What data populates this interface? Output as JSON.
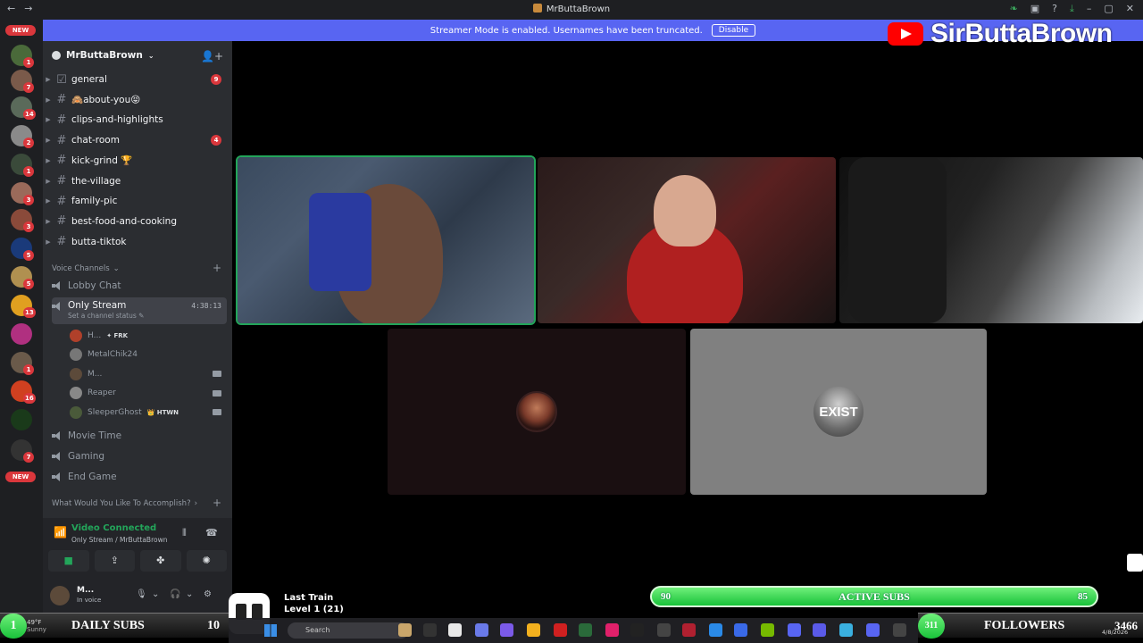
{
  "window": {
    "title": "MrButtaBrown"
  },
  "banner": {
    "text": "Streamer Mode is enabled. Usernames have been truncated.",
    "button": "Disable"
  },
  "youtube_overlay": {
    "channel": "SirButtaBrown"
  },
  "rail": {
    "items": [
      {
        "badge": "NEW",
        "color": "#6a8e5a"
      },
      {
        "badge": "1",
        "color": "#4a6a3a"
      },
      {
        "badge": "7",
        "color": "#7a5a4a"
      },
      {
        "badge": "14",
        "color": "#5a6a5a"
      },
      {
        "badge": "2",
        "color": "#8a8a8a"
      },
      {
        "badge": "1",
        "color": "#3a4a3a"
      },
      {
        "badge": "3",
        "color": "#9a6a5a"
      },
      {
        "badge": "3",
        "color": "#8a4a3a"
      },
      {
        "badge": "5",
        "color": "#1a3a7a"
      },
      {
        "badge": "5",
        "color": "#b09050"
      },
      {
        "badge": "13",
        "color": "#e0a020"
      },
      {
        "badge": "",
        "color": "#b03080"
      },
      {
        "badge": "1",
        "color": "#6a5a4a"
      },
      {
        "badge": "16",
        "color": "#d04020"
      },
      {
        "badge": "",
        "color": "#1a3a1a"
      },
      {
        "badge": "7",
        "color": "#333333"
      },
      {
        "badge": "NEW",
        "color": "#111111"
      }
    ]
  },
  "server": {
    "name": "MrButtaBrown"
  },
  "text_channels": [
    {
      "name": "general",
      "unread": "9"
    },
    {
      "name": "🙈about-you😝",
      "unread": ""
    },
    {
      "name": "clips-and-highlights",
      "unread": ""
    },
    {
      "name": "chat-room",
      "unread": "4"
    },
    {
      "name": "kick-grind 🏆",
      "unread": ""
    },
    {
      "name": "the-village",
      "unread": ""
    },
    {
      "name": "family-pic",
      "unread": ""
    },
    {
      "name": "best-food-and-cooking",
      "unread": ""
    },
    {
      "name": "butta-tiktok",
      "unread": ""
    }
  ],
  "voice_category": "Voice Channels",
  "voice_channels": {
    "lobby": "Lobby Chat",
    "active": {
      "name": "Only Stream",
      "timer": "4:38:13",
      "status": "Set a channel status"
    },
    "members": [
      {
        "name": "H...",
        "tag": "✦ FRK",
        "color": "#b0402a",
        "camera": false
      },
      {
        "name": "MetalChik24",
        "tag": "",
        "color": "#777777",
        "camera": false
      },
      {
        "name": "M...",
        "tag": "",
        "color": "#5c4a3a",
        "camera": true
      },
      {
        "name": "Reaper",
        "tag": "",
        "color": "#888888",
        "camera": true
      },
      {
        "name": "SleeperGhost",
        "tag": "👑 HTWN",
        "color": "#4a5a3a",
        "camera": true
      }
    ],
    "others": [
      "Movie Time",
      "Gaming",
      "End Game"
    ]
  },
  "category2": "What Would You Like To Accomplish?",
  "voice_panel": {
    "title": "Video Connected",
    "subtitle": "Only Stream / MrButtaBrown"
  },
  "user_panel": {
    "name": "M...",
    "status": "In voice"
  },
  "tiles": {
    "t5_label": "EXIST"
  },
  "active_subs": {
    "left": "90",
    "label": "ACTIVE SUBS",
    "right": "85"
  },
  "daily_subs": {
    "num": "1",
    "label": "DAILY SUBS",
    "value": "10"
  },
  "followers": {
    "num": "311",
    "label": "FOLLOWERS",
    "value": "3466"
  },
  "train": {
    "title": "Last Train",
    "level": "Level 1  (21)"
  },
  "taskbar": {
    "search": "Search",
    "temp": "49°F",
    "weather": "Sunny",
    "date": "4/8/2026"
  }
}
